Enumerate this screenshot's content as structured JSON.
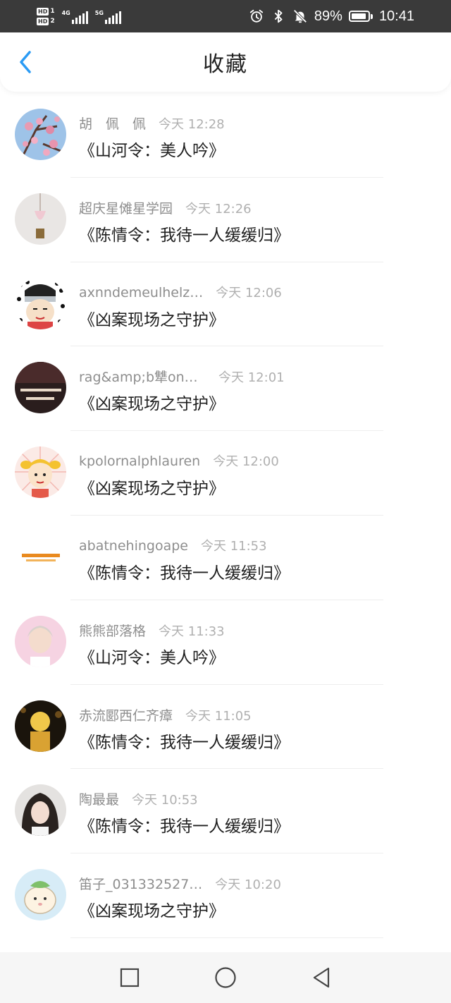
{
  "status_bar": {
    "sim1": "HD",
    "sim1_num": "1",
    "sim2": "HD",
    "sim2_num": "2",
    "net1": "4G",
    "net2": "5G",
    "battery": "89%",
    "time": "10:41",
    "icons": [
      "alarm-icon",
      "bluetooth-icon",
      "mute-bell-icon",
      "battery-icon"
    ]
  },
  "header": {
    "title": "收藏",
    "back_icon": "chevron-left-icon",
    "accent_color": "#2b9bf4"
  },
  "items": [
    {
      "user": "胡　佩　佩",
      "time": "今天 12:28",
      "title": "《山河令：美人吟》",
      "avatar": "plum-blossom"
    },
    {
      "user": "超庆星傩星学园",
      "time": "今天 12:26",
      "title": "《陈情令：我待一人缓缓归》",
      "avatar": "pink-pendant"
    },
    {
      "user": "axnndemeulhelz…",
      "time": "今天 12:06",
      "title": "《凶案现场之守护》",
      "avatar": "cartoon-ninja"
    },
    {
      "user": "rag&amp;b犨on玖e",
      "time": "今天 12:01",
      "title": "《凶案现场之守护》",
      "avatar": "dark-text-image"
    },
    {
      "user": "kpolornalphlauren",
      "time": "今天 12:00",
      "title": "《凶案现场之守护》",
      "avatar": "cartoon-girl"
    },
    {
      "user": "abatnehingoape",
      "time": "今天 11:53",
      "title": "《陈情令：我待一人缓缓归》",
      "avatar": "text-logo"
    },
    {
      "user": "熊熊部落格",
      "time": "今天 11:33",
      "title": "《山河令：美人吟》",
      "avatar": "portrait-pink"
    },
    {
      "user": "赤流郾西仁齐瘴",
      "time": "今天 11:05",
      "title": "《陈情令：我待一人缓缓归》",
      "avatar": "yellow-figure"
    },
    {
      "user": "陶最最",
      "time": "今天 10:53",
      "title": "《陈情令：我待一人缓缓归》",
      "avatar": "girl-photo"
    },
    {
      "user": "笛子_031332527…",
      "time": "今天 10:20",
      "title": "《凶案现场之守护》",
      "avatar": "cartoon-hamster"
    }
  ],
  "nav": {
    "icons": [
      "recent-apps-icon",
      "home-icon",
      "back-triangle-icon"
    ]
  }
}
